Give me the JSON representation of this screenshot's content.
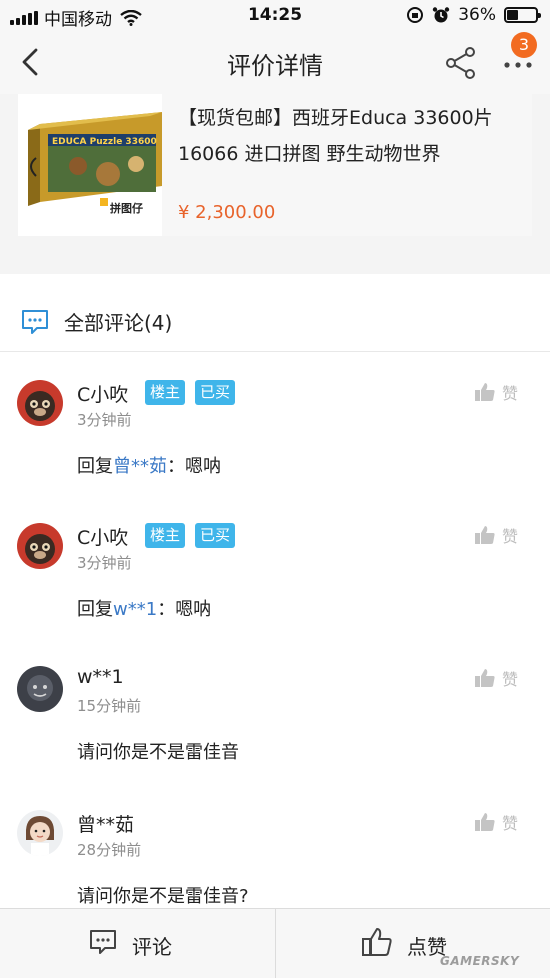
{
  "status_bar": {
    "carrier": "中国移动",
    "time": "14:25",
    "battery": "36%"
  },
  "nav": {
    "title": "评价详情",
    "badge_count": "3"
  },
  "product": {
    "title": "【现货包邮】西班牙Educa 33600片16066 进口拼图 野生动物世界",
    "price": "¥ 2,300.00",
    "thumb_box_text": "EDUCA Puzzle 33600",
    "thumb_logo_text": "拼图仔"
  },
  "comments_header": {
    "label": "全部评论(4)"
  },
  "comments": [
    {
      "name": "C小吹",
      "tags": [
        "楼主",
        "已买"
      ],
      "time": "3分钟前",
      "reply_prefix": "回复",
      "reply_to": "曾**茹",
      "reply_sep": "：",
      "text": "嗯呐",
      "like_label": "赞"
    },
    {
      "name": "C小吹",
      "tags": [
        "楼主",
        "已买"
      ],
      "time": "3分钟前",
      "reply_prefix": "回复",
      "reply_to": "w**1",
      "reply_sep": "：",
      "text": "嗯呐",
      "like_label": "赞"
    },
    {
      "name": "w**1",
      "tags": [],
      "time": "15分钟前",
      "text": "请问你是不是雷佳音",
      "like_label": "赞"
    },
    {
      "name": "曾**茹",
      "tags": [],
      "time": "28分钟前",
      "text": "请问你是不是雷佳音?",
      "like_label": "赞"
    }
  ],
  "bottom_bar": {
    "comment_label": "评论",
    "like_label": "点赞"
  },
  "watermark": "GAMERSKY",
  "colors": {
    "accent_orange": "#f26b21",
    "price": "#e8632b",
    "tag_blue": "#3fb5ea",
    "link_blue": "#3b79c6",
    "icon_blue": "#2f8fd6"
  }
}
